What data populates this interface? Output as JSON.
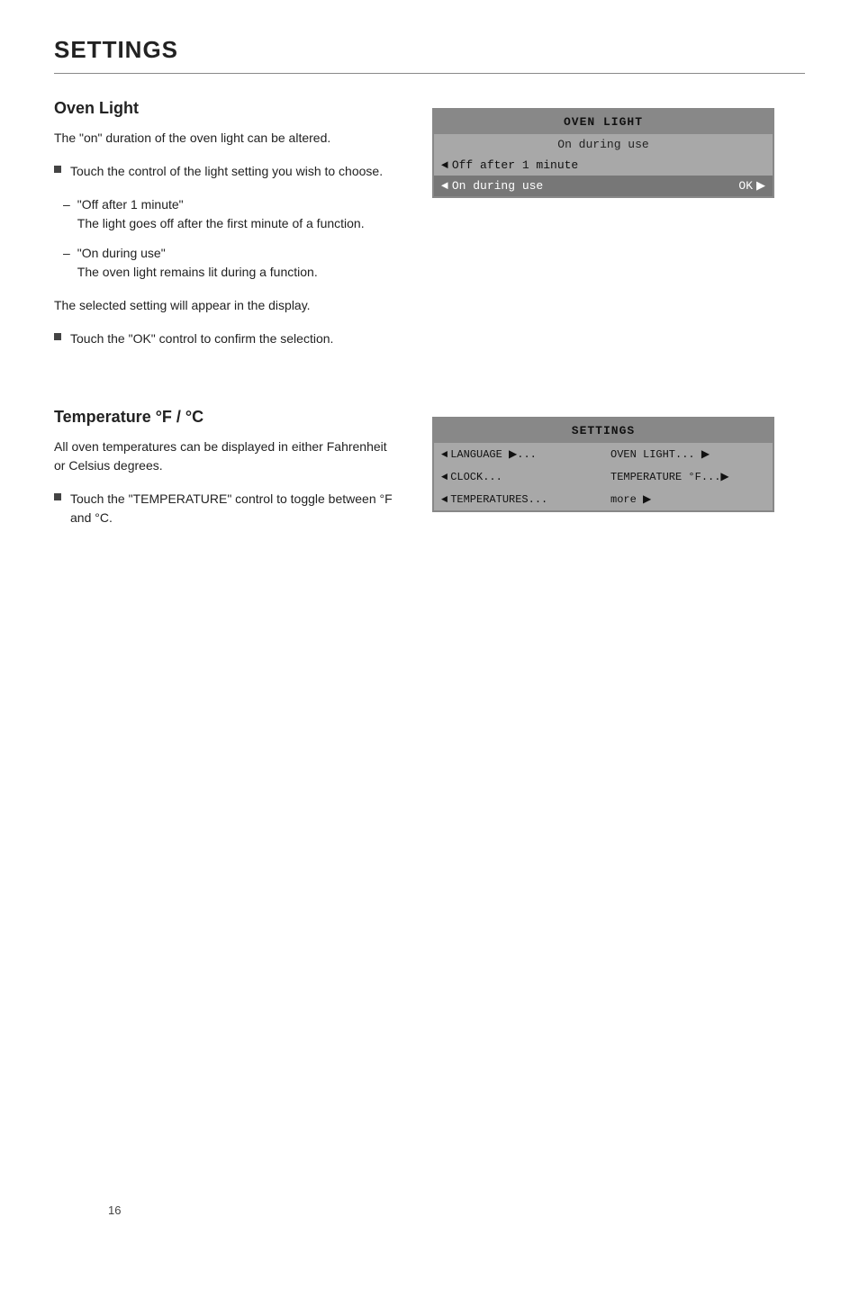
{
  "page": {
    "title": "SETTINGS",
    "page_number": "16"
  },
  "oven_light_section": {
    "heading": "Oven Light",
    "intro": "The \"on\" duration of the oven light can be altered.",
    "bullet1": "Touch the control of the light setting you wish to choose.",
    "dash1_label": "\"Off after 1 minute\"",
    "dash1_desc": "The light goes off after the first minute of a function.",
    "dash2_label": "\"On during use\"",
    "dash2_desc": "The oven light remains lit during a function.",
    "selected_note": "The selected setting will appear in the display.",
    "bullet2": "Touch the \"OK\" control to confirm the selection.",
    "display": {
      "title": "OVEN LIGHT",
      "subtitle": "On during use",
      "row1_text": "Off after 1 minute",
      "row2_text": "On during use",
      "row2_ok": "OK"
    }
  },
  "temperature_section": {
    "heading": "Temperature °F / °C",
    "intro": "All oven temperatures can be displayed in either Fahrenheit or Celsius degrees.",
    "bullet1": "Touch the \"TEMPERATURE\" control to toggle between °F and °C.",
    "display": {
      "title": "SETTINGS",
      "cell1": "LANGUAGE ▶...",
      "cell2": "OVEN LIGHT... ▶",
      "cell3": "CLOCK...",
      "cell4": "TEMPERATURE °F...▶",
      "cell5": "TEMPERATURES...",
      "cell6": "more ▶"
    }
  }
}
